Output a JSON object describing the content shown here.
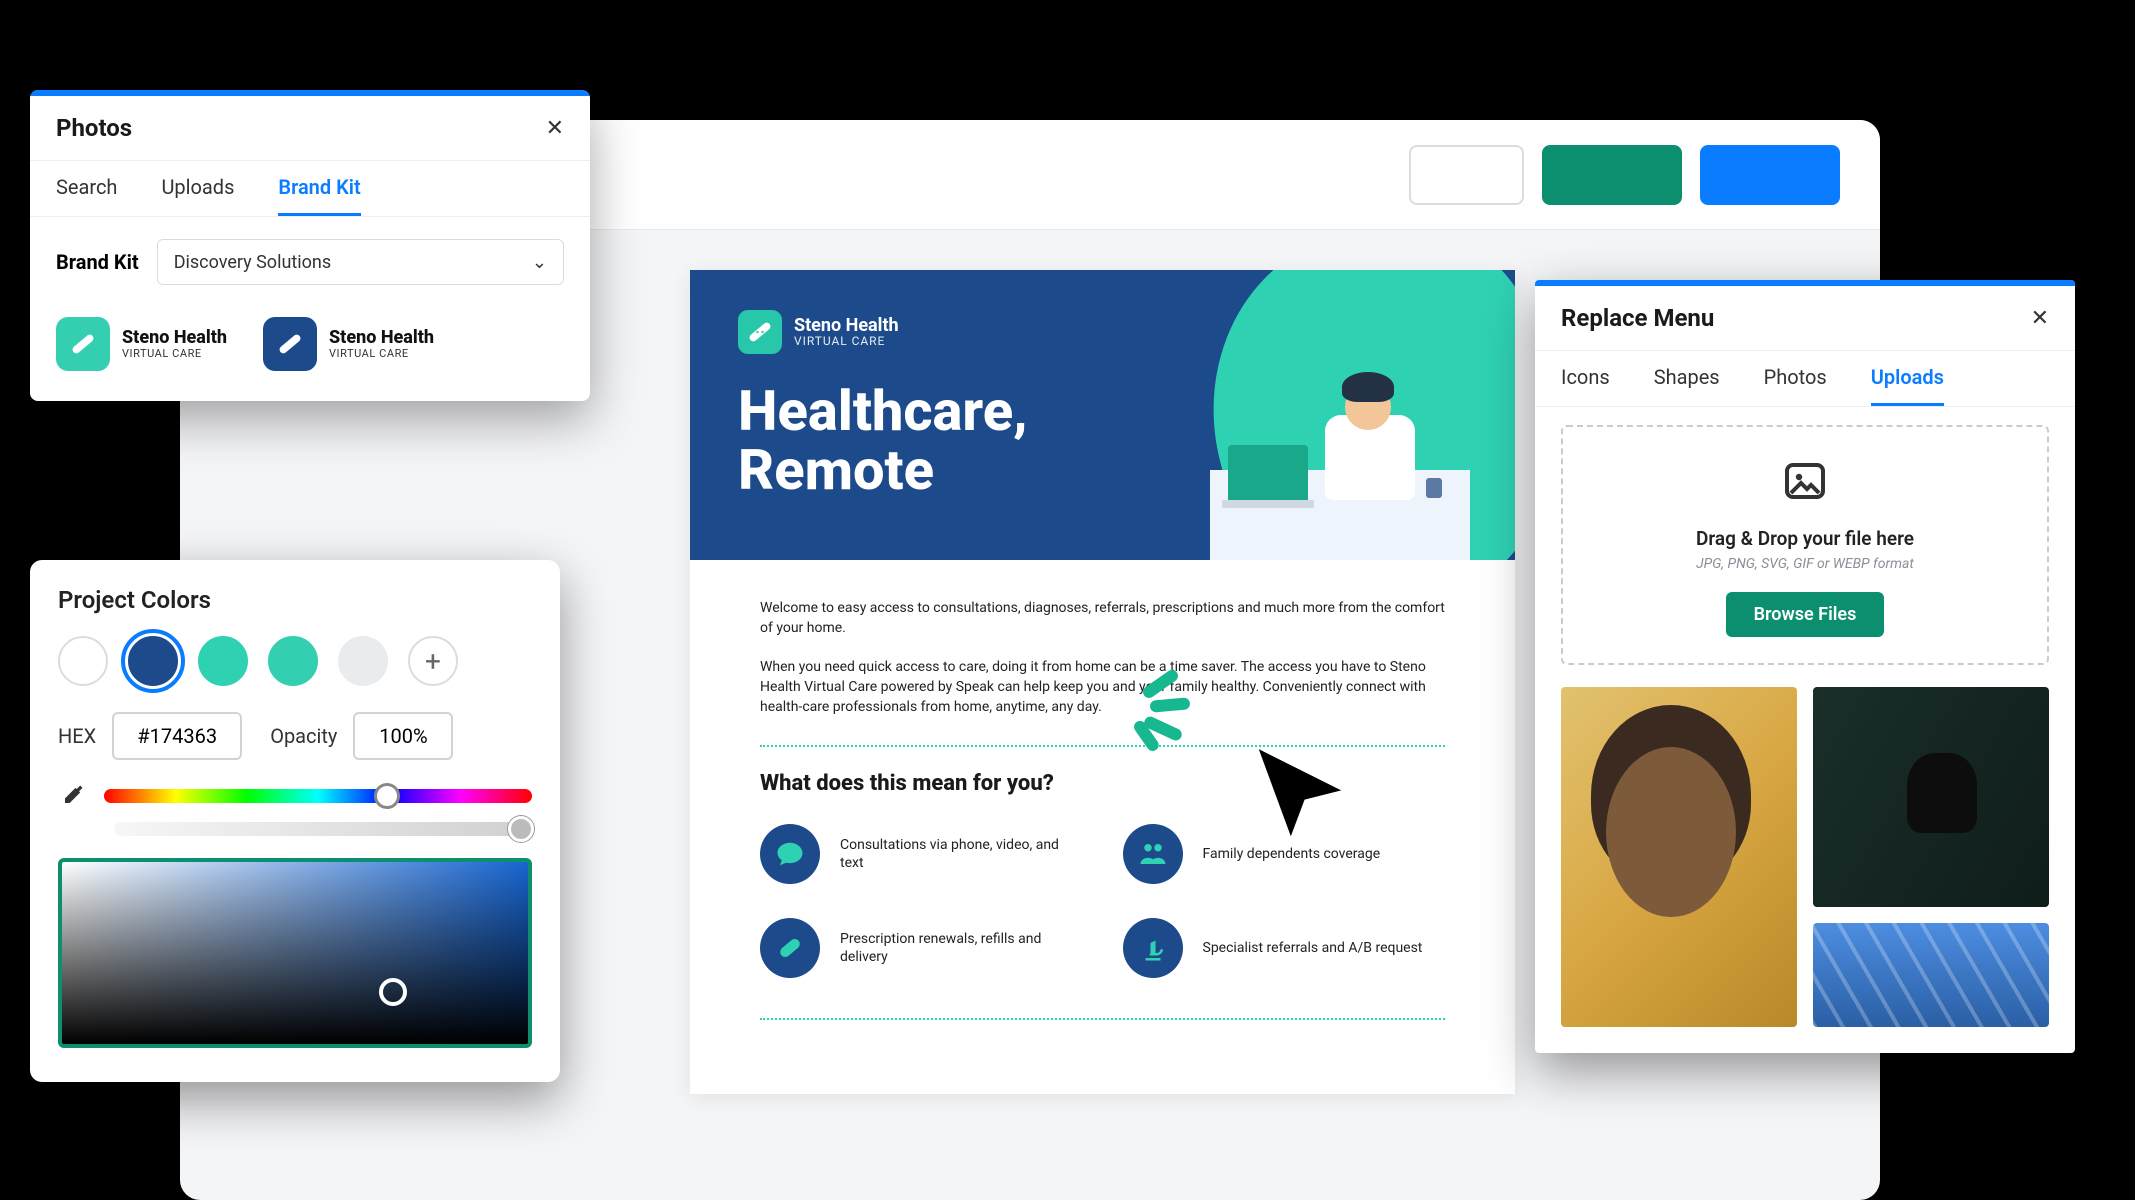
{
  "photos_panel": {
    "title": "Photos",
    "tabs": {
      "search": "Search",
      "uploads": "Uploads",
      "brandkit": "Brand Kit"
    },
    "brandkit_label": "Brand Kit",
    "brandkit_selected": "Discovery Solutions",
    "logo_name": "Steno Health",
    "logo_sub": "VIRTUAL CARE"
  },
  "color_panel": {
    "title": "Project Colors",
    "hex_label": "HEX",
    "hex_value": "#174363",
    "opacity_label": "Opacity",
    "opacity_value": "100%",
    "swatches": [
      "#ffffff",
      "#1c4a8b",
      "#2fd1b3",
      "#33cfb0",
      "#e8ecef"
    ]
  },
  "replace_panel": {
    "title": "Replace Menu",
    "tabs": {
      "icons": "Icons",
      "shapes": "Shapes",
      "photos": "Photos",
      "uploads": "Uploads"
    },
    "drop_title": "Drag & Drop your file here",
    "drop_sub": "JPG, PNG, SVG, GIF or WEBP format",
    "browse": "Browse Files"
  },
  "flyer": {
    "logo_name": "Steno Health",
    "logo_sub": "VIRTUAL CARE",
    "title_line1": "Healthcare,",
    "title_line2": "Remote",
    "para1": "Welcome to easy access to consultations, diagnoses, referrals, prescriptions and much more from the comfort of your home.",
    "para2": "When you need quick access to care, doing it from home can be a time saver. The access you have to Steno Health Virtual Care powered by Speak can help keep you and your family healthy. Conveniently connect with health-care professionals from home, anytime, any day.",
    "h2": "What does this mean for you?",
    "features": [
      "Consultations via phone, video, and text",
      "Family dependents coverage",
      "Prescription renewals, refills and delivery",
      "Specialist referrals and A/B request"
    ]
  }
}
